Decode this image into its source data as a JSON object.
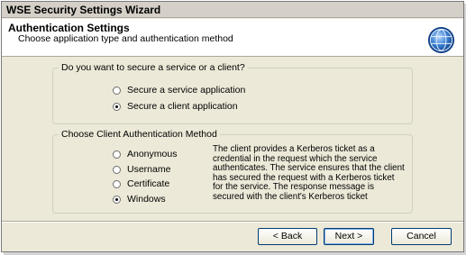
{
  "window": {
    "title": "WSE Security Settings Wizard"
  },
  "header": {
    "title": "Authentication Settings",
    "subtitle": "Choose application type and authentication method",
    "icon": "globe-icon"
  },
  "service_group": {
    "legend": "Do you want to secure a service or a client?",
    "options": [
      {
        "label": "Secure a service application",
        "checked": false
      },
      {
        "label": "Secure a client application",
        "checked": true
      }
    ]
  },
  "auth_group": {
    "legend": "Choose Client Authentication Method",
    "options": [
      {
        "label": "Anonymous",
        "checked": false
      },
      {
        "label": "Username",
        "checked": false
      },
      {
        "label": "Certificate",
        "checked": false
      },
      {
        "label": "Windows",
        "checked": true
      }
    ],
    "description": "The client provides a Kerberos ticket as a credential in the request which the service authenticates. The service ensures that the client has secured the request with a Kerberos ticket for the service. The response message is secured with the client's Kerberos ticket"
  },
  "buttons": {
    "back": "< Back",
    "next": "Next >",
    "cancel": "Cancel"
  }
}
